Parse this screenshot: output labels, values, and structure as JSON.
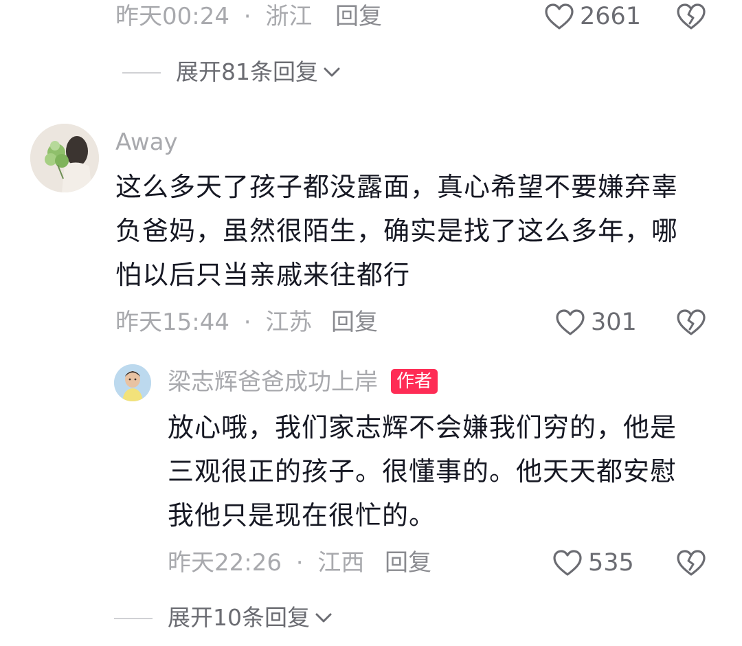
{
  "top_comment_meta": {
    "time": "昨天00:24",
    "sep": "·",
    "location": "浙江",
    "reply": "回复",
    "likes": "2661"
  },
  "expand_1": {
    "label": "展开81条回复"
  },
  "comment_1": {
    "username": "Away",
    "text_lines": [
      "这么多天了孩子都没露面，真心希望不要嫌弃辜",
      "负爸妈，虽然很陌生，确实是找了这么多年，哪",
      "怕以后只当亲戚来往都行"
    ],
    "time": "昨天15:44",
    "sep": "·",
    "location": "江苏",
    "reply": "回复",
    "likes": "301"
  },
  "reply_1": {
    "username": "梁志辉爸爸成功上岸",
    "badge": "作者",
    "text_lines": [
      "放心哦，我们家志辉不会嫌我们穷的，他是",
      "三观很正的孩子。很懂事的。他天天都安慰",
      "我他只是现在很忙的。"
    ],
    "time": "昨天22:26",
    "sep": "·",
    "location": "江西",
    "reply": "回复",
    "likes": "535"
  },
  "expand_2": {
    "label": "展开10条回复"
  },
  "icons": {
    "like": "heart-outline-icon",
    "dislike": "broken-heart-icon",
    "expand": "chevron-down-icon"
  },
  "colors": {
    "badge": "#fe2c55",
    "meta_gray": "#a8a9ad",
    "text": "#161823"
  }
}
